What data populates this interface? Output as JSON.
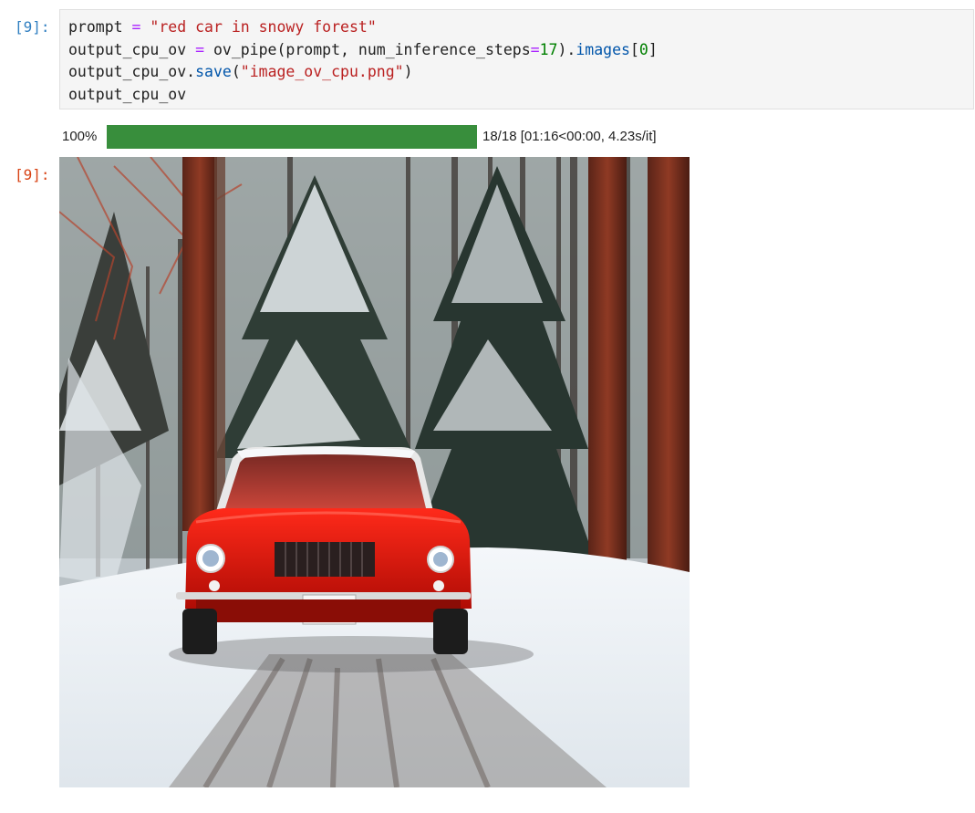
{
  "cell": {
    "input_prompt": "[9]:",
    "output_prompt": "[9]:",
    "code_lines": [
      [
        {
          "t": "prompt "
        },
        {
          "t": "=",
          "c": "kw"
        },
        {
          "t": " "
        },
        {
          "t": "\"red car in snowy forest\"",
          "c": "str"
        }
      ],
      [
        {
          "t": "output_cpu_ov "
        },
        {
          "t": "=",
          "c": "kw"
        },
        {
          "t": " ov_pipe(prompt, num_inference_steps"
        },
        {
          "t": "=",
          "c": "kw"
        },
        {
          "t": "17",
          "c": "num"
        },
        {
          "t": ")."
        },
        {
          "t": "images",
          "c": "attr"
        },
        {
          "t": "["
        },
        {
          "t": "0",
          "c": "num"
        },
        {
          "t": "]"
        }
      ],
      [
        {
          "t": "output_cpu_ov."
        },
        {
          "t": "save",
          "c": "attr"
        },
        {
          "t": "("
        },
        {
          "t": "\"image_ov_cpu.png\"",
          "c": "str"
        },
        {
          "t": ")"
        }
      ],
      [
        {
          "t": "output_cpu_ov"
        }
      ]
    ]
  },
  "progress": {
    "percent_label": "100%",
    "fraction": 1.0,
    "stats": "18/18 [01:16<00:00, 4.23s/it]",
    "bar_color": "#388e3c"
  },
  "output_image": {
    "subject": "red car in snowy forest"
  },
  "colors": {
    "input_prompt": "#307fc1",
    "output_prompt": "#d84315",
    "keyword": "#aa22ff",
    "string": "#ba2121",
    "number": "#008000"
  }
}
